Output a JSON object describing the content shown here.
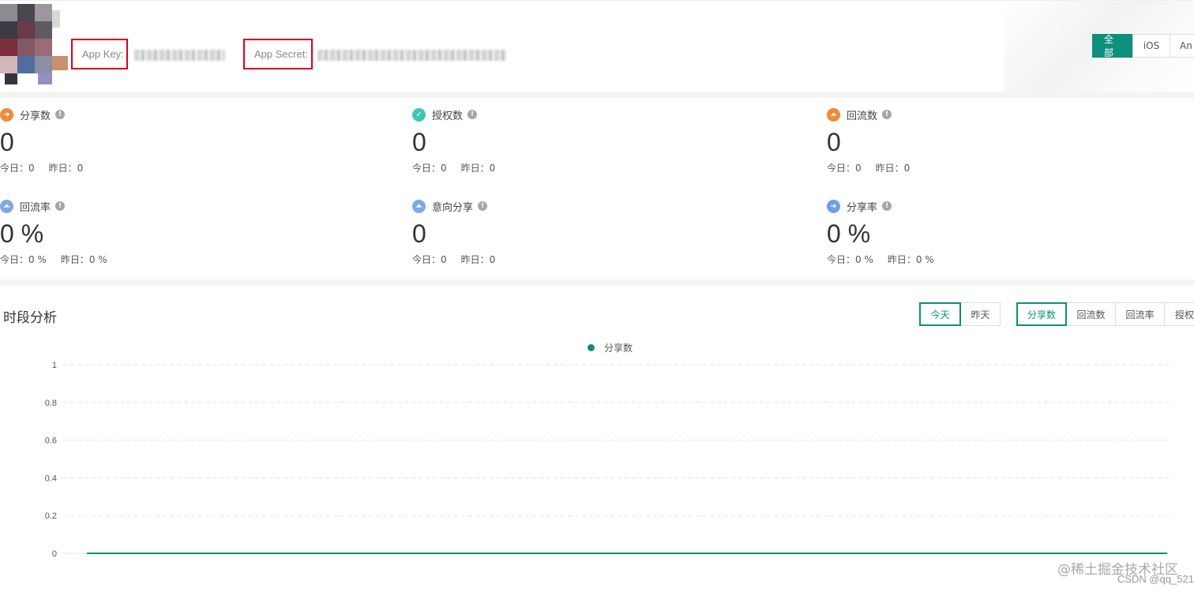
{
  "header": {
    "app_key_label": "App Key:",
    "app_secret_label": "App Secret:",
    "platforms": [
      "全部",
      "iOS",
      "An"
    ],
    "active_platform": "全部"
  },
  "stats": [
    {
      "name": "share-count",
      "title": "分享数",
      "icon": "share-arrow-icon",
      "color": "#f08a3c",
      "value": "0",
      "today": "今日：0",
      "yesterday": "昨日：0"
    },
    {
      "name": "auth-count",
      "title": "授权数",
      "icon": "shield-check-icon",
      "color": "#3cc8b4",
      "value": "0",
      "today": "今日：0",
      "yesterday": "昨日：0"
    },
    {
      "name": "backflow-count",
      "title": "回流数",
      "icon": "backflow-icon",
      "color": "#f08a3c",
      "value": "0",
      "today": "今日：0",
      "yesterday": "昨日：0"
    },
    {
      "name": "backflow-rate",
      "title": "回流率",
      "icon": "backflow-rate-icon",
      "color": "#7fa8e8",
      "value": "0 %",
      "today": "今日：0 %",
      "yesterday": "昨日：0 %"
    },
    {
      "name": "intent-share",
      "title": "意向分享",
      "icon": "intent-share-icon",
      "color": "#7fa8e8",
      "value": "0",
      "today": "今日：0",
      "yesterday": "昨日：0"
    },
    {
      "name": "share-rate",
      "title": "分享率",
      "icon": "share-rate-icon",
      "color": "#6f9ee8",
      "value": "0 %",
      "today": "今日：0 %",
      "yesterday": "昨日：0 %"
    }
  ],
  "analysis": {
    "title": "时段分析",
    "day_tabs": [
      "今天",
      "昨天"
    ],
    "active_day": "今天",
    "metric_tabs": [
      "分享数",
      "回流数",
      "回流率",
      "授权"
    ],
    "active_metric": "分享数"
  },
  "chart_data": {
    "type": "line",
    "series": [
      {
        "name": "分享数",
        "values": [
          0,
          0
        ],
        "color": "#0e8f7c"
      }
    ],
    "y_ticks": [
      "1",
      "0.8",
      "0.6",
      "0.4",
      "0.2",
      "0"
    ],
    "ylim": [
      0,
      1
    ],
    "grid": true,
    "legend_position": "top-center"
  },
  "watermark": {
    "line1": "@稀土掘金技术社区",
    "line2": "CSDN @qq_521"
  }
}
